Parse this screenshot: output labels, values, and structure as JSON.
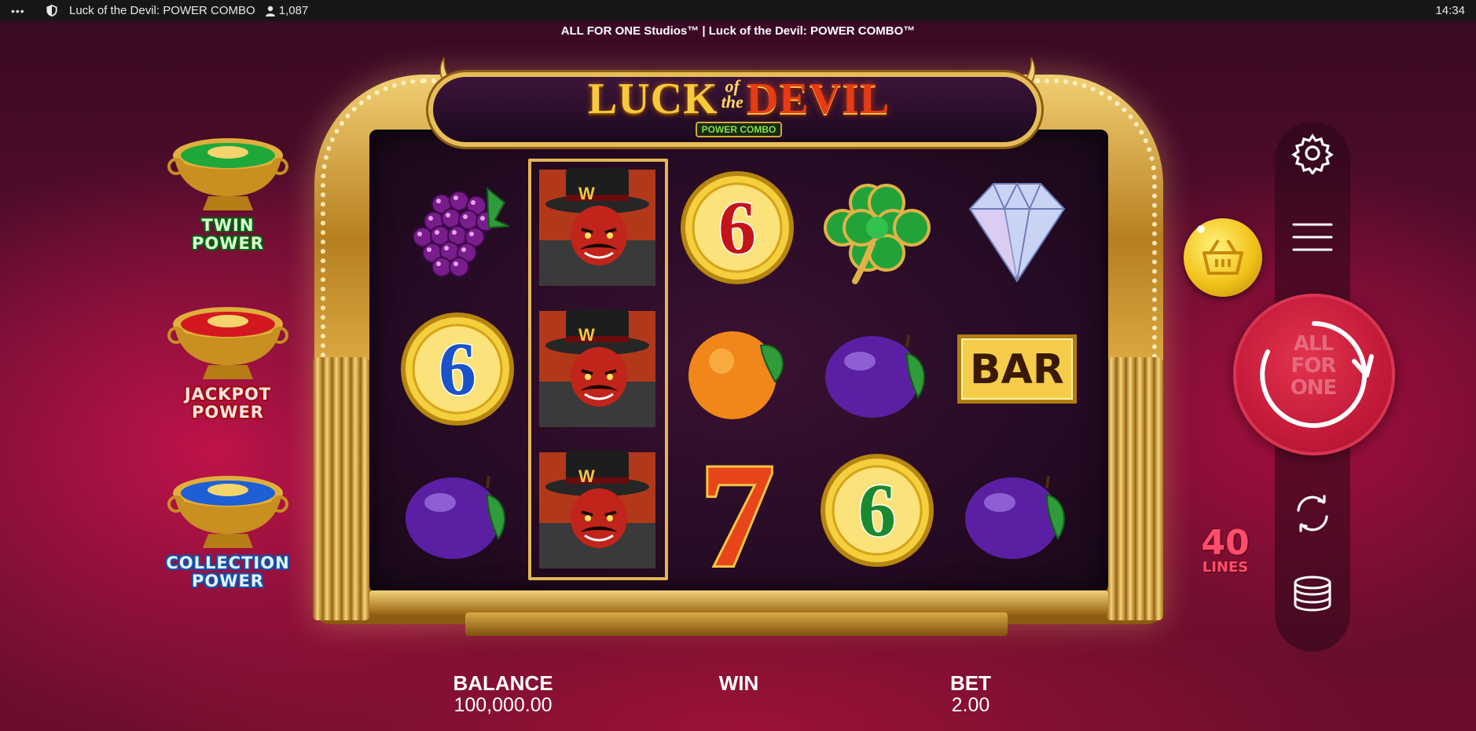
{
  "topbar": {
    "menu_glyph": "•••",
    "shield_icon": "shield-icon",
    "title": "Luck of the Devil: POWER COMBO",
    "viewers": "1,087",
    "viewer_icon": "user-icon",
    "clock": "14:34"
  },
  "game": {
    "provider_title": "ALL FOR ONE Studios™ | Luck of the Devil: POWER COMBO™",
    "logo": {
      "luck": "LUCK",
      "of": "of",
      "the": "the",
      "devil": "DEVIL",
      "sub": "POWER COMBO"
    },
    "powers": [
      {
        "line1": "TWIN",
        "line2": "POWER",
        "pot_color": "#1fa83a"
      },
      {
        "line1": "JACKPOT",
        "line2": "POWER",
        "pot_color": "#d4181f"
      },
      {
        "line1": "COLLECTION",
        "line2": "POWER",
        "pot_color": "#1f5fd6"
      }
    ],
    "reels": [
      [
        "grapes",
        "devil",
        "gold-6-red",
        "clover",
        "diamond"
      ],
      [
        "gold-6-blue",
        "devil",
        "orange",
        "plum",
        "bar"
      ],
      [
        "plum",
        "devil",
        "seven",
        "gold-6-green",
        "plum"
      ]
    ],
    "bar_text": "BAR",
    "six_text": "6",
    "seven_text": "7",
    "hat_letter": "W",
    "lines": {
      "count": "40",
      "label": "LINES"
    },
    "spin": {
      "line1": "ALL",
      "line2": "FOR",
      "line3": "ONE"
    },
    "controls": {
      "settings_icon": "gear-icon",
      "menu_icon": "hamburger-menu-icon",
      "buy_icon": "shopping-basket-icon",
      "autoplay_icon": "autoplay-arrows-icon",
      "bet_icon": "coin-stack-icon",
      "spin_icon": "spin-arrow-icon"
    },
    "bottom": {
      "balance_label": "BALANCE",
      "balance_value": "100,000.00",
      "win_label": "WIN",
      "win_value": "",
      "bet_label": "BET",
      "bet_value": "2.00"
    },
    "colors": {
      "accent_gold": "#e7bd59",
      "spin_red": "#c41a3a",
      "lines_red": "#ff4d6d"
    }
  }
}
